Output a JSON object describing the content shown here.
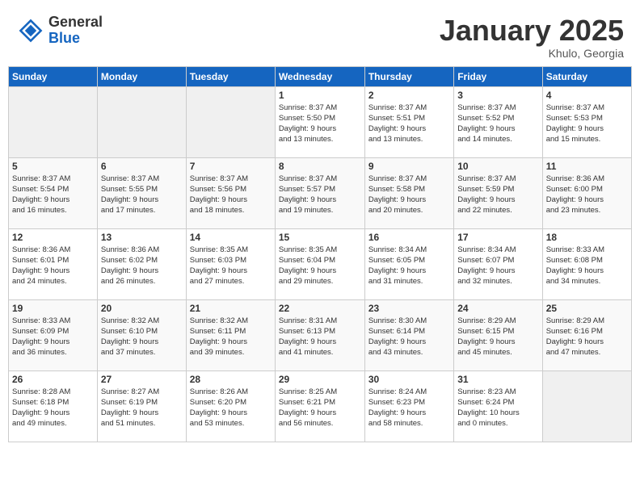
{
  "header": {
    "logo_general": "General",
    "logo_blue": "Blue",
    "month_title": "January 2025",
    "subtitle": "Khulo, Georgia"
  },
  "weekdays": [
    "Sunday",
    "Monday",
    "Tuesday",
    "Wednesday",
    "Thursday",
    "Friday",
    "Saturday"
  ],
  "weeks": [
    [
      {
        "day": "",
        "info": ""
      },
      {
        "day": "",
        "info": ""
      },
      {
        "day": "",
        "info": ""
      },
      {
        "day": "1",
        "info": "Sunrise: 8:37 AM\nSunset: 5:50 PM\nDaylight: 9 hours\nand 13 minutes."
      },
      {
        "day": "2",
        "info": "Sunrise: 8:37 AM\nSunset: 5:51 PM\nDaylight: 9 hours\nand 13 minutes."
      },
      {
        "day": "3",
        "info": "Sunrise: 8:37 AM\nSunset: 5:52 PM\nDaylight: 9 hours\nand 14 minutes."
      },
      {
        "day": "4",
        "info": "Sunrise: 8:37 AM\nSunset: 5:53 PM\nDaylight: 9 hours\nand 15 minutes."
      }
    ],
    [
      {
        "day": "5",
        "info": "Sunrise: 8:37 AM\nSunset: 5:54 PM\nDaylight: 9 hours\nand 16 minutes."
      },
      {
        "day": "6",
        "info": "Sunrise: 8:37 AM\nSunset: 5:55 PM\nDaylight: 9 hours\nand 17 minutes."
      },
      {
        "day": "7",
        "info": "Sunrise: 8:37 AM\nSunset: 5:56 PM\nDaylight: 9 hours\nand 18 minutes."
      },
      {
        "day": "8",
        "info": "Sunrise: 8:37 AM\nSunset: 5:57 PM\nDaylight: 9 hours\nand 19 minutes."
      },
      {
        "day": "9",
        "info": "Sunrise: 8:37 AM\nSunset: 5:58 PM\nDaylight: 9 hours\nand 20 minutes."
      },
      {
        "day": "10",
        "info": "Sunrise: 8:37 AM\nSunset: 5:59 PM\nDaylight: 9 hours\nand 22 minutes."
      },
      {
        "day": "11",
        "info": "Sunrise: 8:36 AM\nSunset: 6:00 PM\nDaylight: 9 hours\nand 23 minutes."
      }
    ],
    [
      {
        "day": "12",
        "info": "Sunrise: 8:36 AM\nSunset: 6:01 PM\nDaylight: 9 hours\nand 24 minutes."
      },
      {
        "day": "13",
        "info": "Sunrise: 8:36 AM\nSunset: 6:02 PM\nDaylight: 9 hours\nand 26 minutes."
      },
      {
        "day": "14",
        "info": "Sunrise: 8:35 AM\nSunset: 6:03 PM\nDaylight: 9 hours\nand 27 minutes."
      },
      {
        "day": "15",
        "info": "Sunrise: 8:35 AM\nSunset: 6:04 PM\nDaylight: 9 hours\nand 29 minutes."
      },
      {
        "day": "16",
        "info": "Sunrise: 8:34 AM\nSunset: 6:05 PM\nDaylight: 9 hours\nand 31 minutes."
      },
      {
        "day": "17",
        "info": "Sunrise: 8:34 AM\nSunset: 6:07 PM\nDaylight: 9 hours\nand 32 minutes."
      },
      {
        "day": "18",
        "info": "Sunrise: 8:33 AM\nSunset: 6:08 PM\nDaylight: 9 hours\nand 34 minutes."
      }
    ],
    [
      {
        "day": "19",
        "info": "Sunrise: 8:33 AM\nSunset: 6:09 PM\nDaylight: 9 hours\nand 36 minutes."
      },
      {
        "day": "20",
        "info": "Sunrise: 8:32 AM\nSunset: 6:10 PM\nDaylight: 9 hours\nand 37 minutes."
      },
      {
        "day": "21",
        "info": "Sunrise: 8:32 AM\nSunset: 6:11 PM\nDaylight: 9 hours\nand 39 minutes."
      },
      {
        "day": "22",
        "info": "Sunrise: 8:31 AM\nSunset: 6:13 PM\nDaylight: 9 hours\nand 41 minutes."
      },
      {
        "day": "23",
        "info": "Sunrise: 8:30 AM\nSunset: 6:14 PM\nDaylight: 9 hours\nand 43 minutes."
      },
      {
        "day": "24",
        "info": "Sunrise: 8:29 AM\nSunset: 6:15 PM\nDaylight: 9 hours\nand 45 minutes."
      },
      {
        "day": "25",
        "info": "Sunrise: 8:29 AM\nSunset: 6:16 PM\nDaylight: 9 hours\nand 47 minutes."
      }
    ],
    [
      {
        "day": "26",
        "info": "Sunrise: 8:28 AM\nSunset: 6:18 PM\nDaylight: 9 hours\nand 49 minutes."
      },
      {
        "day": "27",
        "info": "Sunrise: 8:27 AM\nSunset: 6:19 PM\nDaylight: 9 hours\nand 51 minutes."
      },
      {
        "day": "28",
        "info": "Sunrise: 8:26 AM\nSunset: 6:20 PM\nDaylight: 9 hours\nand 53 minutes."
      },
      {
        "day": "29",
        "info": "Sunrise: 8:25 AM\nSunset: 6:21 PM\nDaylight: 9 hours\nand 56 minutes."
      },
      {
        "day": "30",
        "info": "Sunrise: 8:24 AM\nSunset: 6:23 PM\nDaylight: 9 hours\nand 58 minutes."
      },
      {
        "day": "31",
        "info": "Sunrise: 8:23 AM\nSunset: 6:24 PM\nDaylight: 10 hours\nand 0 minutes."
      },
      {
        "day": "",
        "info": ""
      }
    ]
  ]
}
